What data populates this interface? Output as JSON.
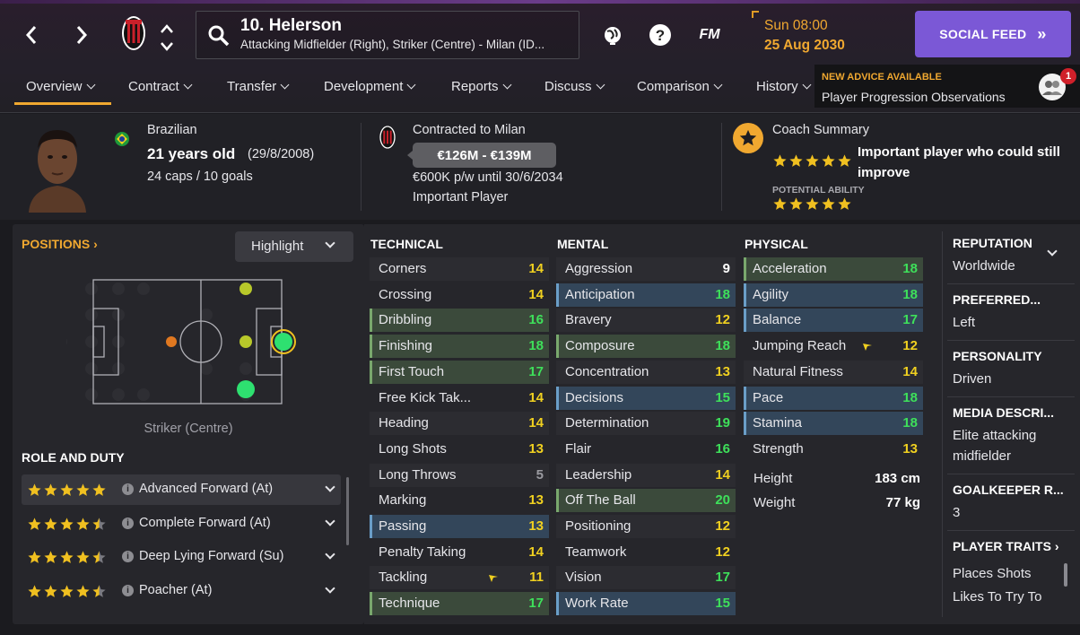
{
  "header": {
    "player_name": "10. Helerson",
    "player_positions": "Attacking Midfielder (Right), Striker (Centre) - Milan (ID...",
    "date_time": "Sun 08:00",
    "date_day": "25 Aug 2030",
    "social_feed_label": "SOCIAL FEED",
    "advice_title": "NEW ADVICE AVAILABLE",
    "advice_text": "Player Progression Observations",
    "advice_count": "1",
    "fm_label": "FM"
  },
  "tabs": [
    "Overview",
    "Contract",
    "Transfer",
    "Development",
    "Reports",
    "Discuss",
    "Comparison",
    "History"
  ],
  "profile": {
    "nationality": "Brazilian",
    "age": "21 years old",
    "dob": "(29/8/2008)",
    "caps": "24 caps / 10 goals",
    "contract_club": "Contracted to Milan",
    "value_range": "€126M - €139M",
    "wage": "€600K p/w until 30/6/2034",
    "squad_status": "Important Player",
    "coach_summary_label": "Coach Summary",
    "coach_summary_text_1": "Important player who could still",
    "coach_summary_text_2": "improve",
    "potential_label": "POTENTIAL ABILITY",
    "current_stars": 5,
    "potential_stars": 5
  },
  "positions": {
    "label": "POSITIONS",
    "highlight_label": "Highlight",
    "selected_position": "Striker (Centre)",
    "role_title": "ROLE AND DUTY",
    "roles": [
      {
        "name": "Advanced Forward (At)",
        "stars": 5,
        "selected": true
      },
      {
        "name": "Complete Forward (At)",
        "stars": 4.5,
        "selected": false
      },
      {
        "name": "Deep Lying Forward (Su)",
        "stars": 4.5,
        "selected": false
      },
      {
        "name": "Poacher (At)",
        "stars": 4.5,
        "selected": false
      }
    ]
  },
  "attributes": {
    "technical_title": "TECHNICAL",
    "mental_title": "MENTAL",
    "physical_title": "PHYSICAL",
    "technical": [
      {
        "name": "Corners",
        "value": "14",
        "hl": ""
      },
      {
        "name": "Crossing",
        "value": "14",
        "hl": ""
      },
      {
        "name": "Dribbling",
        "value": "16",
        "hl": "g"
      },
      {
        "name": "Finishing",
        "value": "18",
        "hl": "g"
      },
      {
        "name": "First Touch",
        "value": "17",
        "hl": "g"
      },
      {
        "name": "Free Kick Tak...",
        "value": "14",
        "hl": ""
      },
      {
        "name": "Heading",
        "value": "14",
        "hl": ""
      },
      {
        "name": "Long Shots",
        "value": "13",
        "hl": ""
      },
      {
        "name": "Long Throws",
        "value": "5",
        "hl": ""
      },
      {
        "name": "Marking",
        "value": "13",
        "hl": ""
      },
      {
        "name": "Passing",
        "value": "13",
        "hl": "b"
      },
      {
        "name": "Penalty Taking",
        "value": "14",
        "hl": ""
      },
      {
        "name": "Tackling",
        "value": "11",
        "hl": "",
        "arrow": true
      },
      {
        "name": "Technique",
        "value": "17",
        "hl": "g"
      }
    ],
    "mental": [
      {
        "name": "Aggression",
        "value": "9",
        "hl": ""
      },
      {
        "name": "Anticipation",
        "value": "18",
        "hl": "b"
      },
      {
        "name": "Bravery",
        "value": "12",
        "hl": ""
      },
      {
        "name": "Composure",
        "value": "18",
        "hl": "g"
      },
      {
        "name": "Concentration",
        "value": "13",
        "hl": ""
      },
      {
        "name": "Decisions",
        "value": "15",
        "hl": "b"
      },
      {
        "name": "Determination",
        "value": "19",
        "hl": ""
      },
      {
        "name": "Flair",
        "value": "16",
        "hl": ""
      },
      {
        "name": "Leadership",
        "value": "14",
        "hl": ""
      },
      {
        "name": "Off The Ball",
        "value": "20",
        "hl": "g"
      },
      {
        "name": "Positioning",
        "value": "12",
        "hl": ""
      },
      {
        "name": "Teamwork",
        "value": "12",
        "hl": ""
      },
      {
        "name": "Vision",
        "value": "17",
        "hl": ""
      },
      {
        "name": "Work Rate",
        "value": "15",
        "hl": "b"
      }
    ],
    "physical": [
      {
        "name": "Acceleration",
        "value": "18",
        "hl": "g"
      },
      {
        "name": "Agility",
        "value": "18",
        "hl": "b"
      },
      {
        "name": "Balance",
        "value": "17",
        "hl": "b"
      },
      {
        "name": "Jumping Reach",
        "value": "12",
        "hl": "",
        "arrow": true
      },
      {
        "name": "Natural Fitness",
        "value": "14",
        "hl": ""
      },
      {
        "name": "Pace",
        "value": "18",
        "hl": "b"
      },
      {
        "name": "Stamina",
        "value": "18",
        "hl": "b"
      },
      {
        "name": "Strength",
        "value": "13",
        "hl": ""
      }
    ],
    "height_label": "Height",
    "height_value": "183 cm",
    "weight_label": "Weight",
    "weight_value": "77 kg"
  },
  "sidebar": {
    "reputation_title": "REPUTATION",
    "reputation_value": "Worldwide",
    "preferred_title": "PREFERRED...",
    "preferred_value": "Left",
    "personality_title": "PERSONALITY",
    "personality_value": "Driven",
    "media_title": "MEDIA DESCRI...",
    "media_value_1": "Elite attacking",
    "media_value_2": "midfielder",
    "gk_title": "GOALKEEPER R...",
    "gk_value": "3",
    "traits_title": "PLAYER TRAITS",
    "traits": [
      "Places Shots",
      "Likes To Try To"
    ]
  },
  "colors": {
    "accent": "#f0a830",
    "social_button": "#7b58d6",
    "highlight_green": "#3b4a3b",
    "highlight_blue": "#33465a",
    "value_high": "#3ee05a",
    "value_mid": "#f0d020"
  },
  "icons": [
    "back-arrow-icon",
    "forward-arrow-icon",
    "club-crest-icon",
    "search-icon",
    "globe-icon",
    "help-icon",
    "fm-logo-icon",
    "star-badge-icon",
    "info-icon",
    "chevron-down-icon",
    "arrow-down-icon"
  ]
}
